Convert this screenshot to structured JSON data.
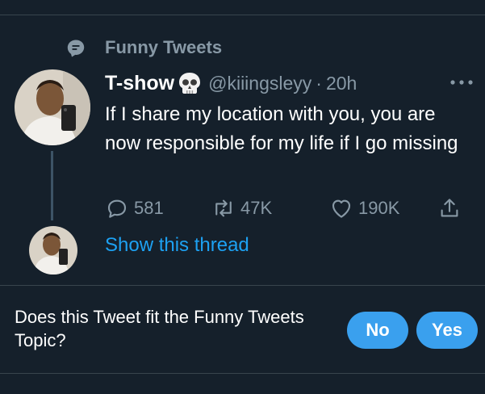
{
  "topic": {
    "label": "Funny Tweets",
    "icon": "topic-icon"
  },
  "tweet": {
    "name": "T-show",
    "name_emoji": "skull-icon",
    "handle": "@kiiingsleyy",
    "separator": "·",
    "time": "20h",
    "text": "If I share my location with you, you are now responsible for my life if I go missing",
    "stats": {
      "replies": "581",
      "retweets": "47K",
      "likes": "190K"
    }
  },
  "thread": {
    "show_label": "Show this thread"
  },
  "topic_prompt": {
    "question": "Does this Tweet fit the Funny Tweets Topic?",
    "no_label": "No",
    "yes_label": "Yes"
  },
  "colors": {
    "background": "#15202b",
    "text_secondary": "#8899a6",
    "link": "#1da1f2",
    "button": "#3aa0ee",
    "divider": "#38444d"
  }
}
